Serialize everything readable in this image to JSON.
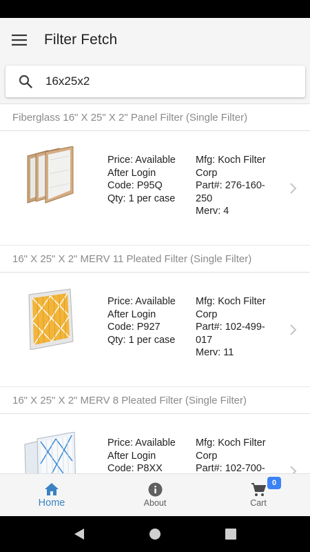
{
  "app": {
    "title": "Filter Fetch"
  },
  "search": {
    "value": "16x25x2",
    "placeholder": ""
  },
  "products": [
    {
      "section_title": "Fiberglass 16\" X 25\" X 2\" Panel Filter (Single Filter)",
      "price_line1": "Price: Available",
      "price_line2": "After Login",
      "code": "Code: P95Q",
      "qty": "Qty: 1 per case",
      "mfg_line1": "Mfg: Koch Filter",
      "mfg_line2": "Corp",
      "part_line1": "Part#: 276-160-",
      "part_line2": "250",
      "merv": "Merv: 4",
      "image": "fiberglass-panel-filter"
    },
    {
      "section_title": "16\" X 25\" X 2\" MERV 11 Pleated Filter (Single Filter)",
      "price_line1": "Price: Available",
      "price_line2": "After Login",
      "code": "Code: P927",
      "qty": "Qty: 1 per case",
      "mfg_line1": "Mfg: Koch Filter",
      "mfg_line2": "Corp",
      "part_line1": "Part#: 102-499-",
      "part_line2": "017",
      "merv": "Merv: 11",
      "image": "yellow-pleated-filter"
    },
    {
      "section_title": "16\" X 25\" X 2\" MERV 8 Pleated Filter (Single Filter)",
      "price_line1": "Price: Available",
      "price_line2": "After Login",
      "code": "Code: P8XX",
      "qty": "",
      "mfg_line1": "Mfg: Koch Filter",
      "mfg_line2": "Corp",
      "part_line1": "Part#: 102-700-",
      "part_line2": "",
      "merv": "",
      "image": "blue-pleated-filter"
    }
  ],
  "bottom_nav": {
    "home": "Home",
    "about": "About",
    "cart": "Cart",
    "cart_count": "0"
  },
  "icons": {
    "menu": "hamburger-menu-icon",
    "search": "search-icon",
    "chevron": "chevron-right-icon",
    "home": "home-icon",
    "about": "info-icon",
    "cart": "cart-icon",
    "back": "back-triangle-icon",
    "home_sys": "home-circle-icon",
    "recents": "recents-square-icon"
  },
  "colors": {
    "accent": "#3b82c4",
    "badge": "#3b82f6",
    "muted_text": "#8a8a8a"
  }
}
